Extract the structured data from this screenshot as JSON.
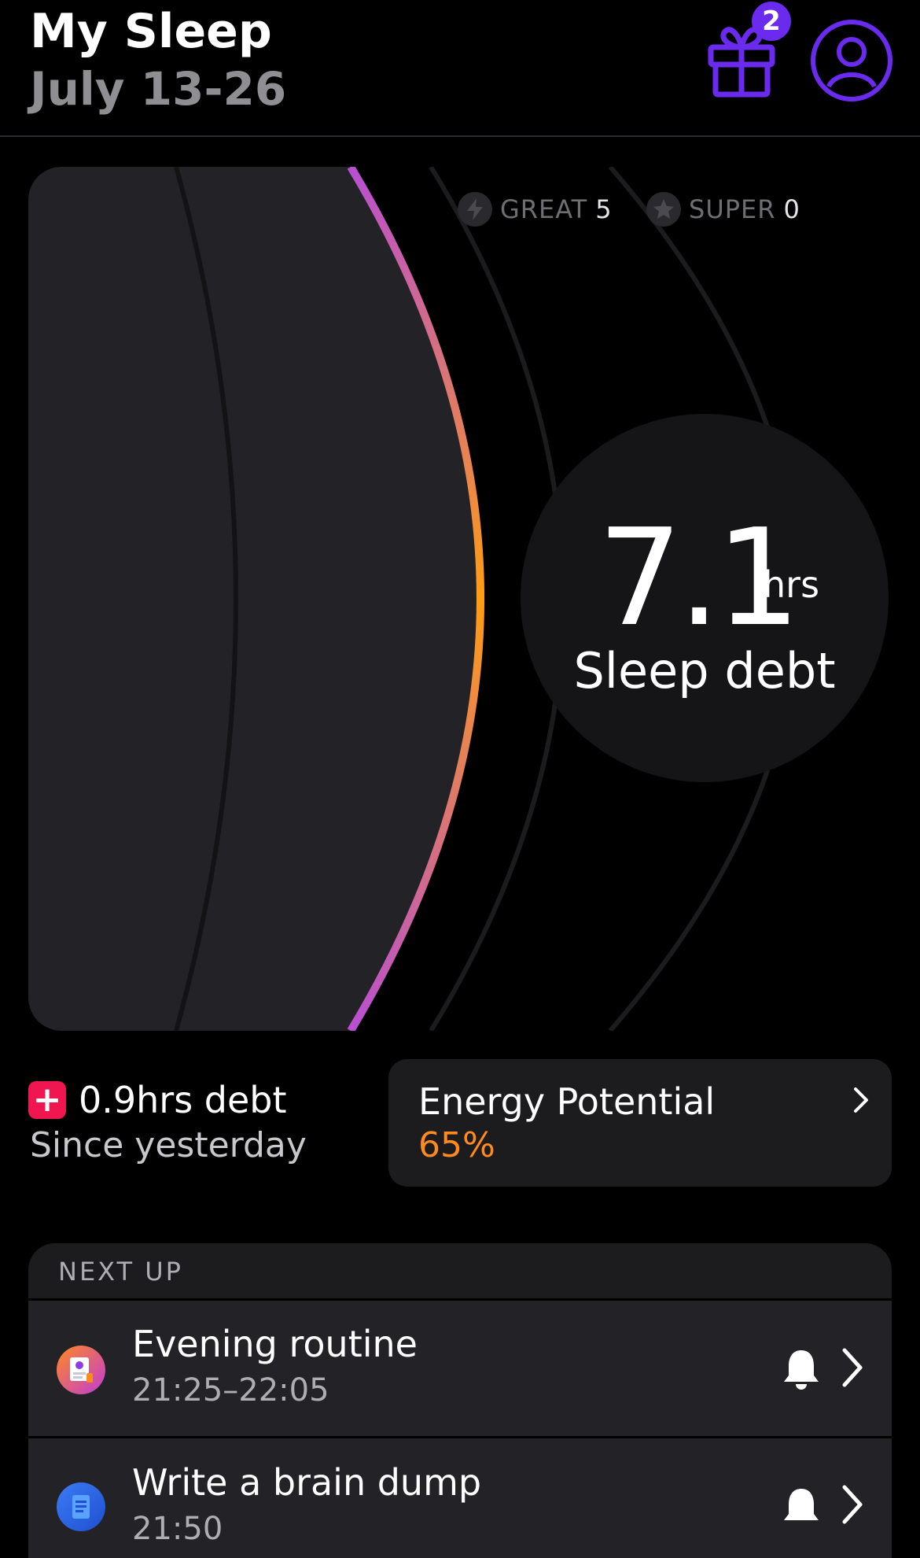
{
  "header": {
    "title": "My Sleep",
    "date_range": "July 13-26",
    "gift_badge_count": "2"
  },
  "stats": [
    {
      "icon": "lightning-icon",
      "label": "GREAT",
      "value": "5"
    },
    {
      "icon": "star-icon",
      "label": "SUPER",
      "value": "0"
    }
  ],
  "sleep_debt": {
    "value": "7.1",
    "unit": "hrs",
    "label": "Sleep debt"
  },
  "daily_change": {
    "sign": "+",
    "text": "0.9hrs debt",
    "subtitle": "Since yesterday"
  },
  "energy": {
    "title": "Energy Potential",
    "value": "65%"
  },
  "next_up": {
    "heading": "NEXT UP",
    "items": [
      {
        "title": "Evening routine",
        "time": "21:25–22:05",
        "icon": "routine-icon"
      },
      {
        "title": "Write a brain dump",
        "time": "21:50",
        "icon": "notes-icon"
      }
    ]
  },
  "colors": {
    "accent": "#6b2bef",
    "energy": "#ff8a1f",
    "debt_positive": "#f0164f",
    "gauge_gradient": [
      "#b84fd2",
      "#ff9d12",
      "#b84fd2"
    ]
  }
}
